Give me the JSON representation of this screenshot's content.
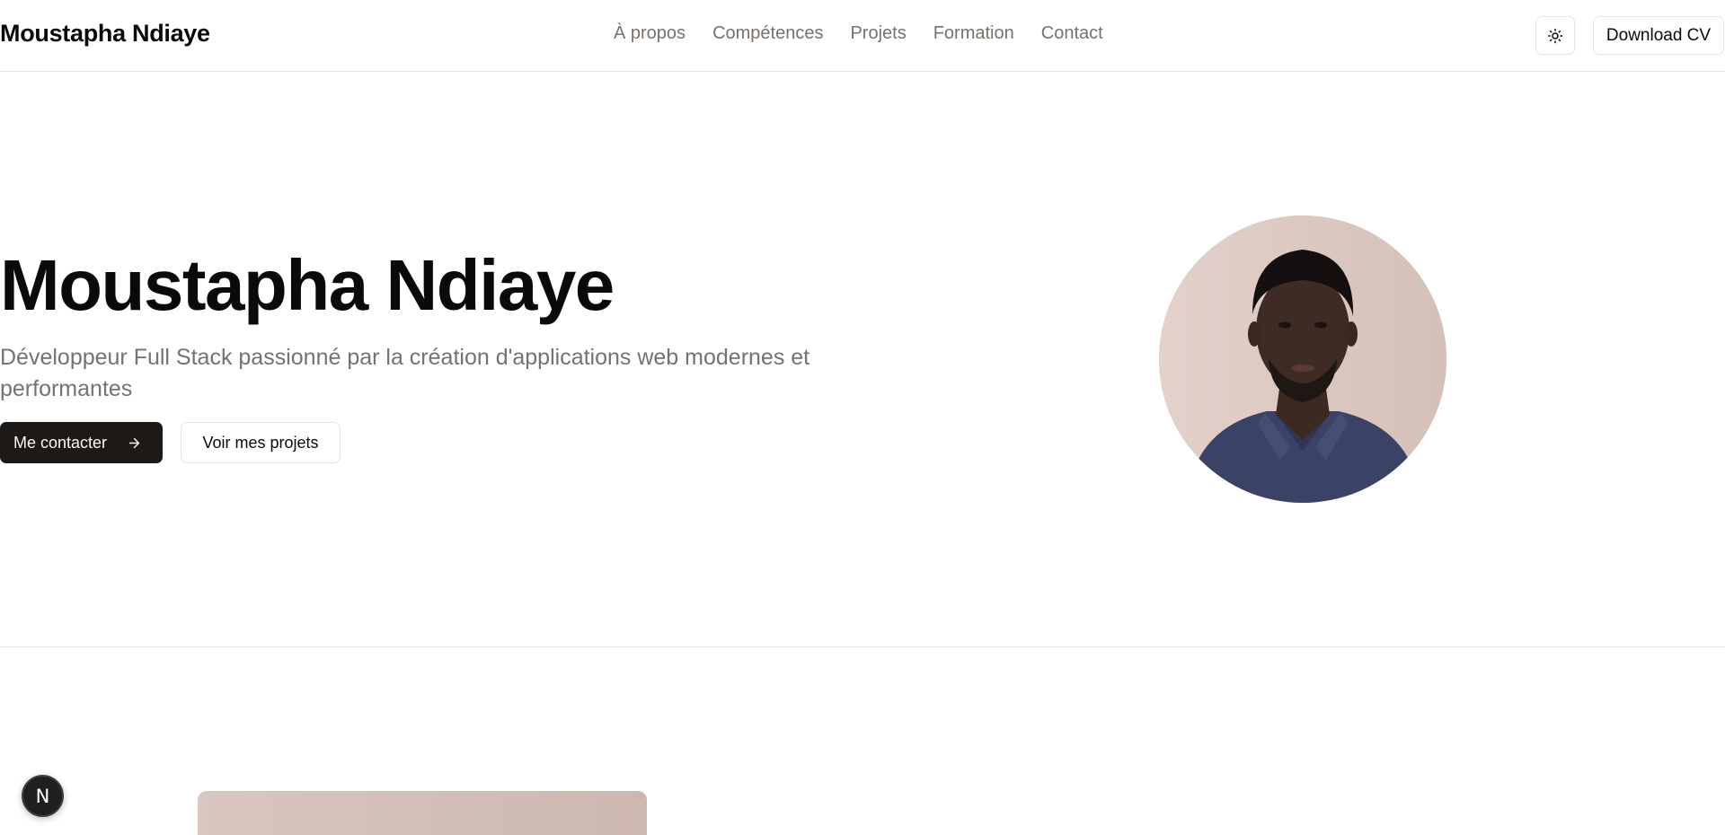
{
  "header": {
    "brand": "Moustapha Ndiaye",
    "nav": [
      {
        "label": "À propos"
      },
      {
        "label": "Compétences"
      },
      {
        "label": "Projets"
      },
      {
        "label": "Formation"
      },
      {
        "label": "Contact"
      }
    ],
    "theme_toggle_icon": "sun-icon",
    "cv_label": "Download CV"
  },
  "hero": {
    "title": "Moustapha Ndiaye",
    "subtitle": "Développeur Full Stack passionné par la création d'applications web modernes et performantes",
    "primary_label": "Me contacter",
    "primary_icon": "arrow-right-icon",
    "secondary_label": "Voir mes projets",
    "avatar_icon": "profile-photo"
  },
  "dev_badge": {
    "label": "N",
    "icon": "nextjs-icon"
  },
  "colors": {
    "text": "#0c0a09",
    "muted": "#78716c",
    "primary_bg": "#1c1917",
    "border": "#e7e5e4",
    "avatar_bg": "#dcc9c2"
  }
}
